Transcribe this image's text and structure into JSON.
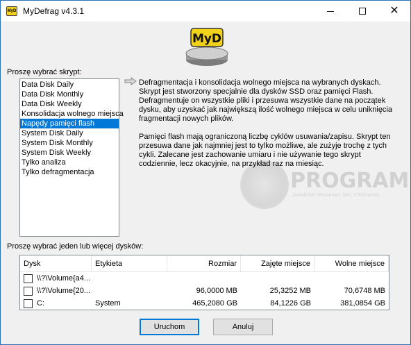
{
  "window": {
    "title": "MyDefrag v4.3.1",
    "icon_text": "MyD"
  },
  "logo": {
    "text": "MyD"
  },
  "watermark": {
    "text": "PROGRAMKI.PL",
    "subtext": "DARMOWE PROGRAMY, GRY, STEROWNIKI"
  },
  "scripts": {
    "label": "Proszę wybrać skrypt:",
    "items": [
      "Data Disk Daily",
      "Data Disk Monthly",
      "Data Disk Weekly",
      "Konsolidacja wolnego miejsca",
      "Napędy pamięci flash",
      "System Disk Daily",
      "System Disk Monthly",
      "System Disk Weekly",
      "Tylko analiza",
      "Tylko defragmentacja"
    ],
    "selected_index": 4
  },
  "description": {
    "paragraphs": [
      "Defragmentacja i konsolidacja wolnego miejsca na wybranych dyskach. Skrypt jest stworzony specjalnie dla dysków SSD oraz pamięci Flash. Defragmentuje on wszystkie pliki i przesuwa wszystkie dane na początek dysku, aby uzyskać jak największą ilość wolnego miejsca w celu uniknięcia fragmentacji nowych plików.",
      "Pamięci flash mają ograniczoną liczbę cyklów usuwania/zapisu. Skrypt ten przesuwa dane jak najmniej jest to tylko możliwe, ale zużyje trochę z tych cykli. Zalecane jest zachowanie umiaru i nie używanie tego skrypt codziennie, lecz okacyjnie, na przykład raz na miesiąc."
    ]
  },
  "disks": {
    "label": "Proszę wybrać jeden lub więcej dysków:",
    "columns": [
      "Dysk",
      "Etykieta",
      "Rozmiar",
      "Zajęte miejsce",
      "Wolne miejsce"
    ],
    "rows": [
      {
        "disk": "\\\\?\\Volume{a4...",
        "label": "",
        "size": "",
        "used": "",
        "free": "",
        "checked": false
      },
      {
        "disk": "\\\\?\\Volume{20...",
        "label": "",
        "size": "96,0000 MB",
        "used": "25,3252 MB",
        "free": "70,6748 MB",
        "checked": false
      },
      {
        "disk": "C:",
        "label": "System",
        "size": "465,2080 GB",
        "used": "84,1226 GB",
        "free": "381,0854 GB",
        "checked": false
      }
    ]
  },
  "buttons": {
    "run": "Uruchom",
    "cancel": "Anuluj"
  },
  "colors": {
    "selection": "#0078d7",
    "logo_yellow": "#f3d21a"
  }
}
